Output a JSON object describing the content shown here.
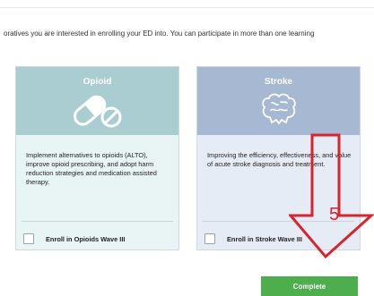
{
  "intro": {
    "text": "oratives you are interested in enrolling your ED into. You can participate in more than one learning"
  },
  "cards": [
    {
      "title": "Opioid",
      "icon": "pill-capsule-icon",
      "description": "Implement alternatives to opioids (ALTO), improve opioid prescribing, and adopt harm reduction strategies and medication assisted therapy.",
      "enroll_label": "Enroll in Opioids Wave III",
      "checked": false
    },
    {
      "title": "Stroke",
      "icon": "brain-icon",
      "description": "Improving the efficiency, effectiveness, and value of acute stroke diagnosis and treatment.",
      "enroll_label": "Enroll in Stroke Wave III",
      "checked": false
    }
  ],
  "actions": {
    "complete_label": "Complete"
  },
  "annotation": {
    "number": "5",
    "color": "#d9232e"
  },
  "colors": {
    "opioid_header": "#a9cdd1",
    "stroke_header": "#a7b9d2",
    "complete_button": "#4cae4c"
  }
}
